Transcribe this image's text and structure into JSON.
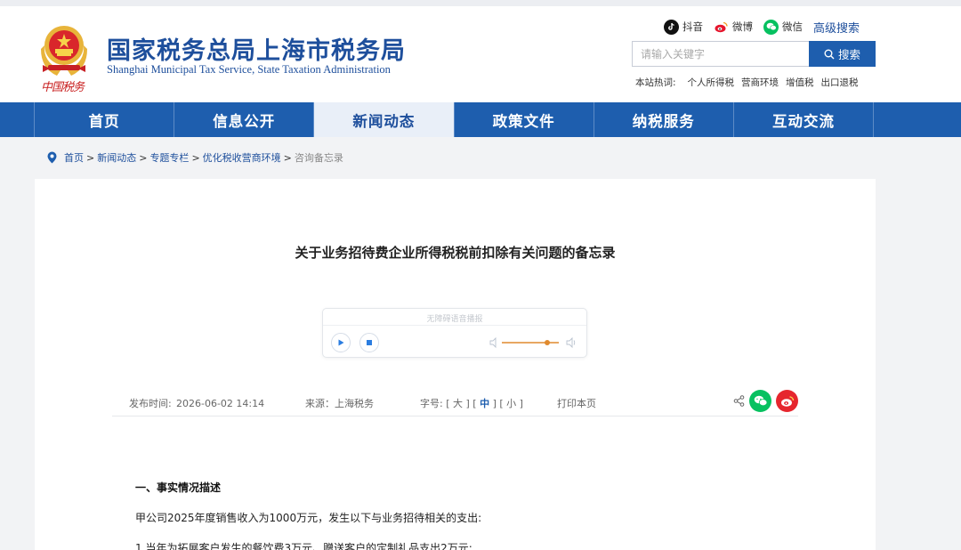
{
  "header": {
    "title": "国家税务总局上海市税务局",
    "subtitle": "Shanghai Municipal Tax Service, State Taxation Administration",
    "emblem_caption": "中国税务",
    "social": [
      {
        "label": "抖音",
        "icon": "douyin-icon",
        "color": "#111111"
      },
      {
        "label": "微博",
        "icon": "weibo-icon",
        "color": "#e6162d"
      },
      {
        "label": "微信",
        "icon": "wechat-icon",
        "color": "#07c160"
      }
    ],
    "advanced_search": "高级搜索",
    "search": {
      "placeholder": "请输入关键字",
      "button": "搜索"
    },
    "hot": {
      "label": "本站热词:",
      "items": [
        "个人所得税",
        "营商环境",
        "增值税",
        "出口退税"
      ]
    }
  },
  "nav": {
    "items": [
      "首页",
      "信息公开",
      "新闻动态",
      "政策文件",
      "纳税服务",
      "互动交流"
    ],
    "active_index": 2
  },
  "breadcrumb": [
    "首页",
    "新闻动态",
    "专题专栏",
    "优化税收营商环境",
    "咨询备忘录"
  ],
  "article": {
    "title": "关于业务招待费企业所得税税前扣除有关问题的备忘录",
    "player": {
      "label": "无障碍语音播报"
    },
    "meta": {
      "publish_label": "发布时间:",
      "publish_time": "2026-06-02 14:14",
      "source": "来源：上海税务",
      "font_label": "字号:",
      "size_large": "大",
      "size_medium": "中",
      "size_small": "小",
      "print": "打印本页"
    },
    "section_title": "一、事实情况描述",
    "paragraphs": [
      "甲公司2025年度销售收入为1000万元，发生以下与业务招待相关的支出:",
      "1.当年为拓展客户发生的餐饮费3万元、赠送客户的定制礼品支出2万元;"
    ]
  },
  "colors": {
    "brand_blue": "#1e5eae",
    "title_blue": "#1e4f9c",
    "nav_active_bg": "#e9eff8"
  }
}
